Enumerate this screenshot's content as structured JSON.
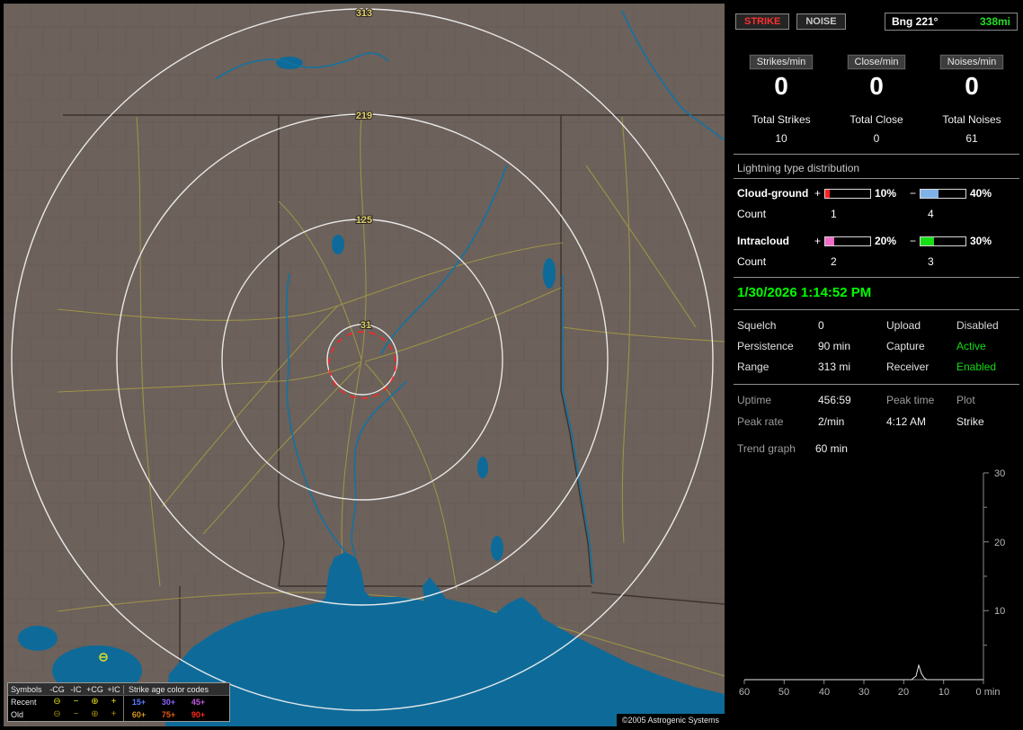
{
  "map": {
    "ring_labels": [
      "313",
      "219",
      "125",
      "31"
    ],
    "copyright": "©2005 Astrogenic Systems",
    "legend": {
      "symbols_header": "Symbols",
      "symbol_headers": [
        "-CG",
        "-IC",
        "+CG",
        "+IC"
      ],
      "age_header": "Strike age color codes",
      "symbol_glyphs": [
        "⊖",
        "−",
        "⊕",
        "+"
      ],
      "rows": [
        {
          "label": "Recent",
          "symbol_color": "#e8e020",
          "ages": [
            {
              "text": "15+",
              "color": "#5a7cff"
            },
            {
              "text": "30+",
              "color": "#8f66ff"
            },
            {
              "text": "45+",
              "color": "#c35ae0"
            }
          ]
        },
        {
          "label": "Old",
          "symbol_color": "#a38e12",
          "ages": [
            {
              "text": "60+",
              "color": "#d79420"
            },
            {
              "text": "75+",
              "color": "#e75b12"
            },
            {
              "text": "90+",
              "color": "#ff2a1a"
            }
          ]
        }
      ]
    }
  },
  "panel": {
    "mode_buttons": [
      {
        "label": "STRIKE",
        "color": "#ff3030"
      },
      {
        "label": "NOISE",
        "color": "#c8c8c8"
      }
    ],
    "bearing": {
      "label": "Bng 221°",
      "distance": "338mi"
    },
    "counters": [
      {
        "label": "Strikes/min",
        "value": "0"
      },
      {
        "label": "Close/min",
        "value": "0"
      },
      {
        "label": "Noises/min",
        "value": "0"
      }
    ],
    "totals": [
      {
        "label": "Total Strikes",
        "value": "10"
      },
      {
        "label": "Total Close",
        "value": "0"
      },
      {
        "label": "Total Noises",
        "value": "61"
      }
    ],
    "distribution": {
      "title": "Lightning type distribution",
      "plus_sign": "+",
      "minus_sign": "−",
      "count_label": "Count",
      "rows": [
        {
          "label": "Cloud-ground",
          "plus_pct": "10%",
          "plus_fill": "10%",
          "plus_color": "#ff2020",
          "minus_pct": "40%",
          "minus_fill": "40%",
          "minus_color": "#7fb2e8",
          "plus_count": "1",
          "minus_count": "4"
        },
        {
          "label": "Intracloud",
          "plus_pct": "20%",
          "plus_fill": "20%",
          "plus_color": "#f06cc8",
          "minus_pct": "30%",
          "minus_fill": "30%",
          "minus_color": "#18e018",
          "plus_count": "2",
          "minus_count": "3"
        }
      ]
    },
    "timestamp": "1/30/2026 1:14:52 PM",
    "status_rows": [
      {
        "l1": "Squelch",
        "v1": "0",
        "l2": "Upload",
        "v2": "Disabled",
        "v2_color": "#d8d8d8"
      },
      {
        "l1": "Persistence",
        "v1": "90 min",
        "l2": "Capture",
        "v2": "Active",
        "v2_color": "#12dd12"
      },
      {
        "l1": "Range",
        "v1": "313 mi",
        "l2": "Receiver",
        "v2": "Enabled",
        "v2_color": "#12dd12"
      }
    ],
    "stats_rows": [
      {
        "c1": "Uptime",
        "c2": "456:59",
        "c3": "Peak time",
        "c4": "Plot"
      },
      {
        "c1": "Peak rate",
        "c2": "2/min",
        "c3": "4:12 AM",
        "c4": "Strike"
      }
    ],
    "trend": {
      "label": "Trend graph",
      "window": "60 min"
    }
  },
  "chart_data": {
    "type": "line",
    "title": "Trend graph",
    "window": "60 min",
    "x_tick_labels": [
      "60",
      "50",
      "40",
      "30",
      "20",
      "10",
      "0 min"
    ],
    "y_tick_labels": [
      "30",
      "20",
      "10"
    ],
    "ylim": [
      0,
      30
    ],
    "x_range_minutes": [
      60,
      0
    ],
    "legend_position": "none",
    "grid": false,
    "series": [
      {
        "name": "Strike",
        "points": [
          [
            60,
            0
          ],
          [
            17,
            0
          ],
          [
            15,
            2
          ],
          [
            13,
            0
          ],
          [
            0,
            0
          ]
        ]
      }
    ]
  }
}
